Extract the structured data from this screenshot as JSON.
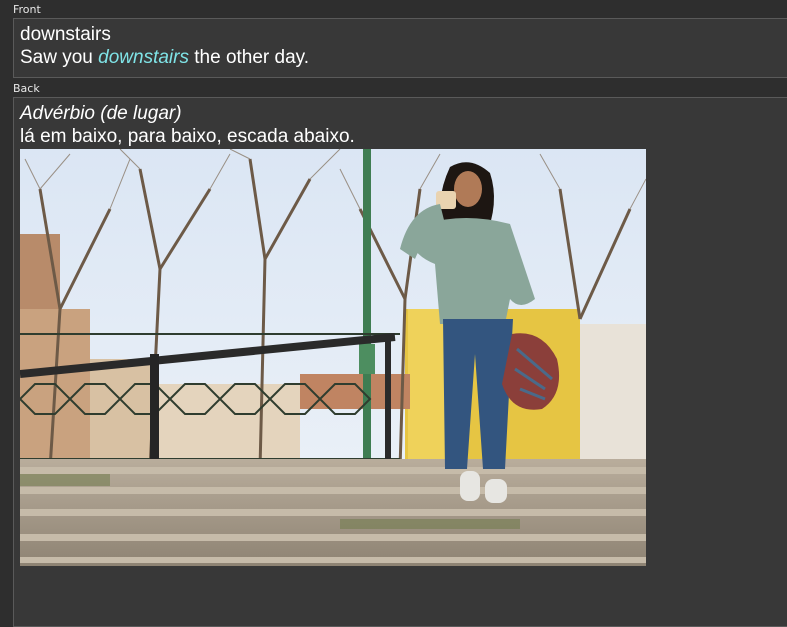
{
  "front": {
    "label": "Front",
    "word": "downstairs",
    "sentence_before": "Saw you ",
    "sentence_highlight": "downstairs",
    "sentence_after": " the other day."
  },
  "back": {
    "label": "Back",
    "part_of_speech": "Advérbio (de lugar)",
    "translation": "lá em baixo, para baixo, escada abaixo."
  },
  "colors": {
    "background": "#2e2e2e",
    "field_background": "#383838",
    "highlight": "#7fe3e6"
  }
}
